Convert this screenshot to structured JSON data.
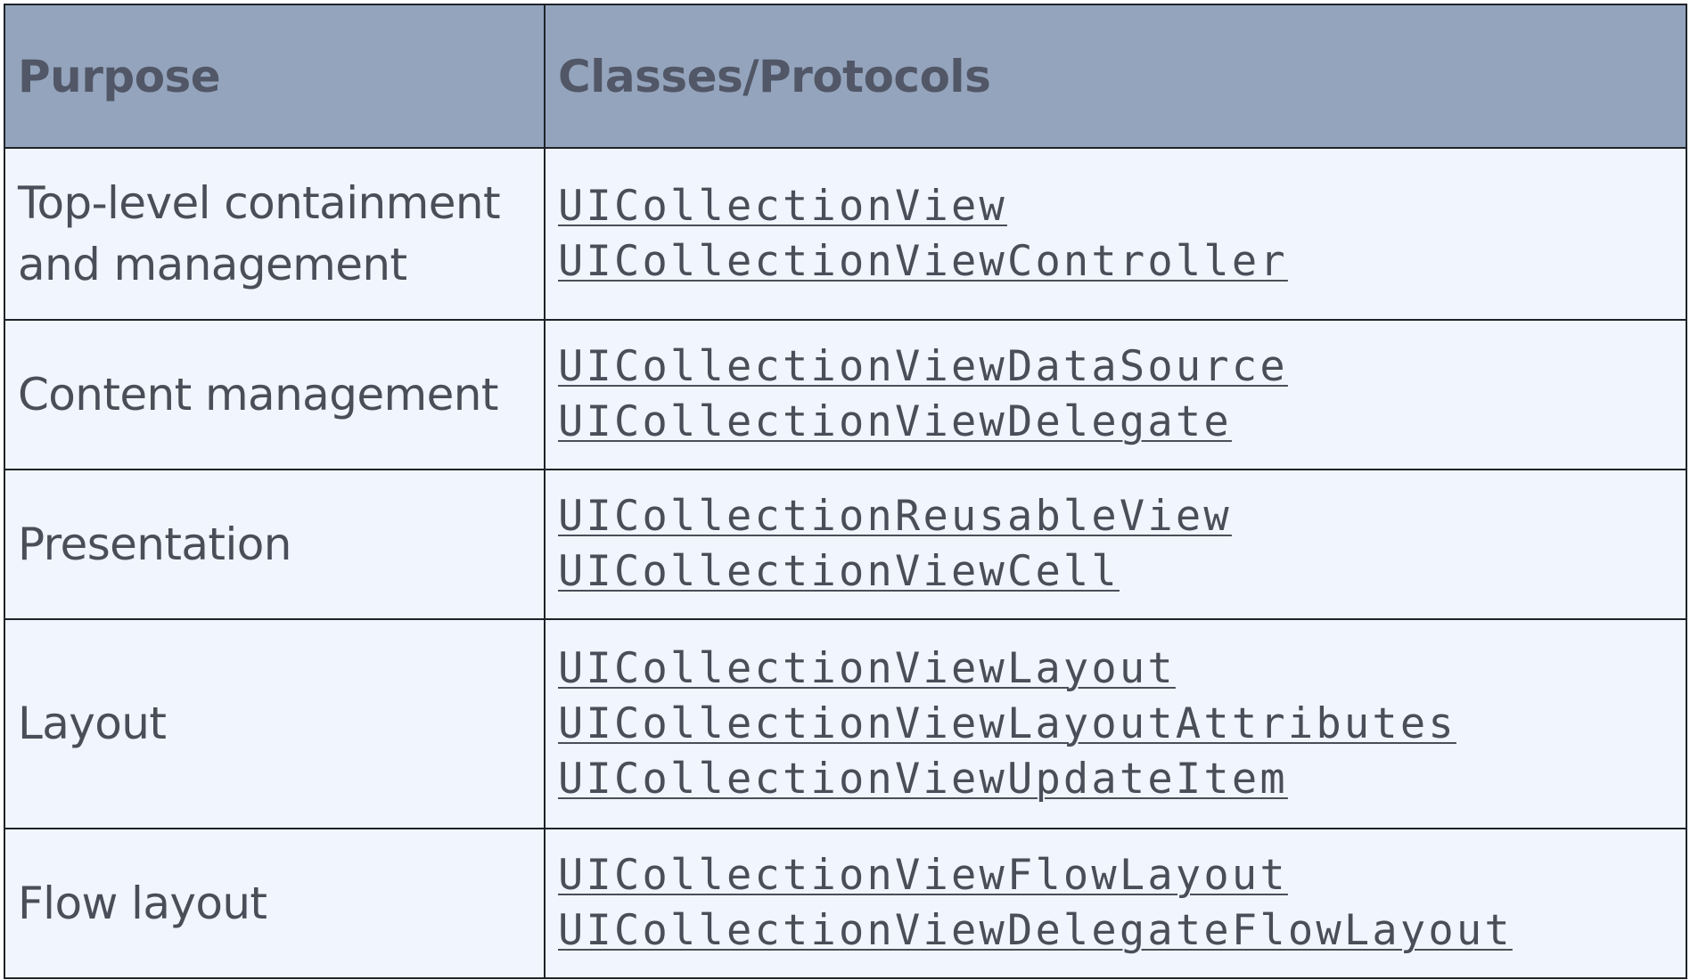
{
  "table": {
    "headers": {
      "purpose": "Purpose",
      "classes": "Classes/Protocols"
    },
    "rows": [
      {
        "purpose_lines": [
          "Top-level containment",
          "and management"
        ],
        "classes": [
          "UICollectionView",
          "UICollectionViewController"
        ]
      },
      {
        "purpose_lines": [
          "Content management"
        ],
        "classes": [
          "UICollectionViewDataSource",
          "UICollectionViewDelegate"
        ]
      },
      {
        "purpose_lines": [
          "Presentation"
        ],
        "classes": [
          "UICollectionReusableView",
          "UICollectionViewCell"
        ]
      },
      {
        "purpose_lines": [
          "Layout"
        ],
        "classes": [
          "UICollectionViewLayout",
          "UICollectionViewLayoutAttributes",
          "UICollectionViewUpdateItem"
        ]
      },
      {
        "purpose_lines": [
          "Flow layout"
        ],
        "classes": [
          "UICollectionViewFlowLayout",
          "UICollectionViewDelegateFlowLayout"
        ]
      }
    ]
  },
  "colors": {
    "header_bg": "#94a4bd",
    "body_bg": "#f0f5fe",
    "text": "#4a4e58",
    "border": "#1f2329"
  }
}
